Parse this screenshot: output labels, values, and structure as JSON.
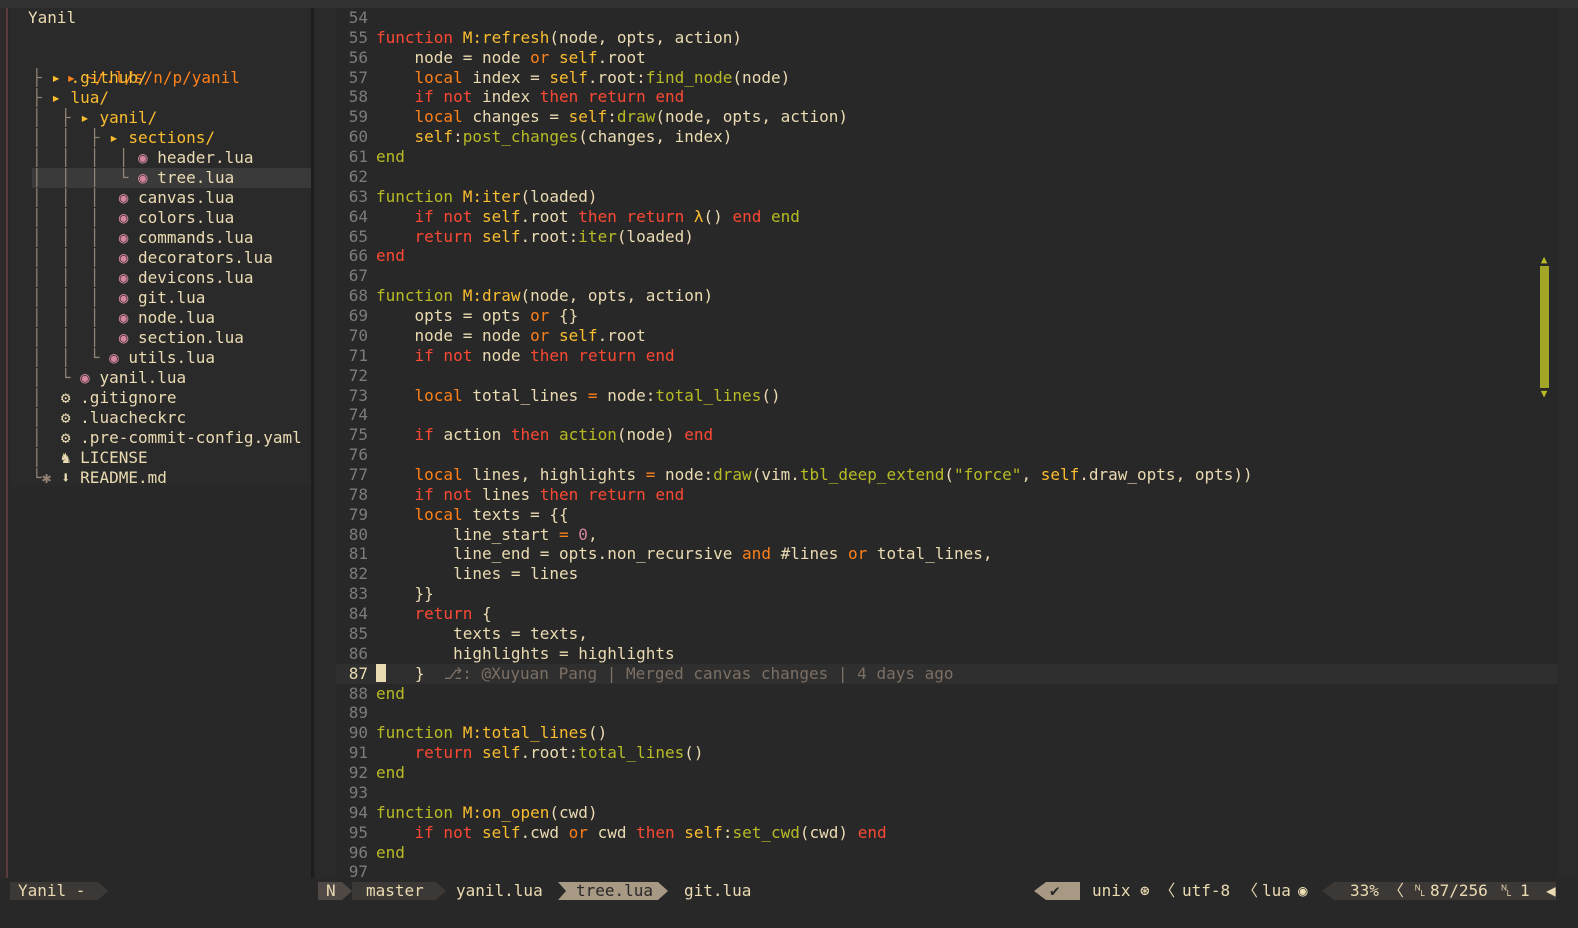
{
  "sidebar": {
    "title": "Yanil",
    "root": "~/.l/s/n/p/yanil",
    "items": [
      {
        "prefix": "├ ",
        "icon": "▸ ",
        "label": ".github/",
        "kind": "dir"
      },
      {
        "prefix": "├ ",
        "icon": "▸ ",
        "label": "lua/",
        "kind": "dir"
      },
      {
        "prefix": "│  ├ ",
        "icon": "▸ ",
        "label": "yanil/",
        "kind": "dir"
      },
      {
        "prefix": "│  │  ├ ",
        "icon": "▸ ",
        "label": "sections/",
        "kind": "dir"
      },
      {
        "prefix": "│  │  │  │ ",
        "icon": "◉ ",
        "label": "header.lua",
        "kind": "lua"
      },
      {
        "prefix": "│  │  │  └ ",
        "icon": "◉ ",
        "label": "tree.lua",
        "kind": "lua"
      },
      {
        "prefix": "│  │  │  ",
        "icon": "◉ ",
        "label": "canvas.lua",
        "kind": "lua"
      },
      {
        "prefix": "│  │  │  ",
        "icon": "◉ ",
        "label": "colors.lua",
        "kind": "lua"
      },
      {
        "prefix": "│  │  │  ",
        "icon": "◉ ",
        "label": "commands.lua",
        "kind": "lua"
      },
      {
        "prefix": "│  │  │  ",
        "icon": "◉ ",
        "label": "decorators.lua",
        "kind": "lua"
      },
      {
        "prefix": "│  │  │  ",
        "icon": "◉ ",
        "label": "devicons.lua",
        "kind": "lua"
      },
      {
        "prefix": "│  │  │  ",
        "icon": "◉ ",
        "label": "git.lua",
        "kind": "lua"
      },
      {
        "prefix": "│  │  │  ",
        "icon": "◉ ",
        "label": "node.lua",
        "kind": "lua"
      },
      {
        "prefix": "│  │  │  ",
        "icon": "◉ ",
        "label": "section.lua",
        "kind": "lua"
      },
      {
        "prefix": "│  │  └ ",
        "icon": "◉ ",
        "label": "utils.lua",
        "kind": "lua"
      },
      {
        "prefix": "│  └ ",
        "icon": "◉ ",
        "label": "yanil.lua",
        "kind": "lua"
      },
      {
        "prefix": "│  ",
        "icon": "⚙ ",
        "label": ".gitignore",
        "kind": "gear"
      },
      {
        "prefix": "│  ",
        "icon": "⚙ ",
        "label": ".luacheckrc",
        "kind": "gear"
      },
      {
        "prefix": "│  ",
        "icon": "⚙ ",
        "label": ".pre-commit-config.yaml",
        "kind": "gear"
      },
      {
        "prefix": "│  ",
        "icon": "♞ ",
        "label": "LICENSE",
        "kind": "gear"
      },
      {
        "prefix": "└✱ ",
        "icon": "⬇ ",
        "label": "README.md",
        "kind": "gear"
      }
    ],
    "selected_index": 5
  },
  "code": {
    "lines": [
      {
        "n": "54",
        "t": []
      },
      {
        "n": "55",
        "t": [
          [
            "k",
            "function "
          ],
          [
            "y",
            "M:refresh"
          ],
          [
            "w",
            "(node, opts, action)"
          ]
        ]
      },
      {
        "n": "56",
        "t": [
          [
            "w",
            "    node = node "
          ],
          [
            "o",
            "or "
          ],
          [
            "y",
            "self"
          ],
          [
            "w",
            ".root"
          ]
        ]
      },
      {
        "n": "57",
        "t": [
          [
            "o",
            "    local "
          ],
          [
            "w",
            "index = "
          ],
          [
            "y",
            "self"
          ],
          [
            "w",
            ".root:"
          ],
          [
            "f",
            "find_node"
          ],
          [
            "w",
            "(node)"
          ]
        ]
      },
      {
        "n": "58",
        "t": [
          [
            "k",
            "    if not "
          ],
          [
            "w",
            "index "
          ],
          [
            "k",
            "then return end"
          ]
        ]
      },
      {
        "n": "59",
        "t": [
          [
            "o",
            "    local "
          ],
          [
            "w",
            "changes = "
          ],
          [
            "y",
            "self"
          ],
          [
            "w",
            ":"
          ],
          [
            "f",
            "draw"
          ],
          [
            "w",
            "(node, opts, action)"
          ]
        ]
      },
      {
        "n": "60",
        "t": [
          [
            "y",
            "    self"
          ],
          [
            "w",
            ":"
          ],
          [
            "f",
            "post_changes"
          ],
          [
            "w",
            "(changes, index)"
          ]
        ]
      },
      {
        "n": "61",
        "t": [
          [
            "g",
            "end"
          ]
        ]
      },
      {
        "n": "62",
        "t": []
      },
      {
        "n": "63",
        "t": [
          [
            "g",
            "function "
          ],
          [
            "y",
            "M:iter"
          ],
          [
            "w",
            "(loaded)"
          ]
        ]
      },
      {
        "n": "64",
        "t": [
          [
            "k",
            "    if not "
          ],
          [
            "y",
            "self"
          ],
          [
            "w",
            ".root "
          ],
          [
            "k",
            "then return "
          ],
          [
            "y",
            "λ"
          ],
          [
            "w",
            "() "
          ],
          [
            "k",
            "end "
          ],
          [
            "g",
            "end"
          ]
        ]
      },
      {
        "n": "65",
        "t": [
          [
            "k",
            "    return "
          ],
          [
            "y",
            "self"
          ],
          [
            "w",
            ".root:"
          ],
          [
            "f",
            "iter"
          ],
          [
            "w",
            "(loaded)"
          ]
        ]
      },
      {
        "n": "66",
        "t": [
          [
            "k",
            "end"
          ]
        ]
      },
      {
        "n": "67",
        "t": []
      },
      {
        "n": "68",
        "t": [
          [
            "g",
            "function "
          ],
          [
            "y",
            "M:draw"
          ],
          [
            "w",
            "(node, opts, action)"
          ]
        ]
      },
      {
        "n": "69",
        "t": [
          [
            "w",
            "    opts = opts "
          ],
          [
            "o",
            "or "
          ],
          [
            "w",
            "{}"
          ]
        ]
      },
      {
        "n": "70",
        "t": [
          [
            "w",
            "    node = node "
          ],
          [
            "o",
            "or "
          ],
          [
            "y",
            "self"
          ],
          [
            "w",
            ".root"
          ]
        ]
      },
      {
        "n": "71",
        "t": [
          [
            "k",
            "    if not "
          ],
          [
            "w",
            "node "
          ],
          [
            "k",
            "then return end"
          ]
        ]
      },
      {
        "n": "72",
        "t": []
      },
      {
        "n": "73",
        "t": [
          [
            "o",
            "    local "
          ],
          [
            "w",
            "total_lines "
          ],
          [
            "o",
            "= "
          ],
          [
            "w",
            "node:"
          ],
          [
            "f",
            "total_lines"
          ],
          [
            "w",
            "()"
          ]
        ]
      },
      {
        "n": "74",
        "t": []
      },
      {
        "n": "75",
        "t": [
          [
            "k",
            "    if "
          ],
          [
            "w",
            "action "
          ],
          [
            "k",
            "then "
          ],
          [
            "f",
            "action"
          ],
          [
            "w",
            "(node) "
          ],
          [
            "k",
            "end"
          ]
        ]
      },
      {
        "n": "76",
        "t": []
      },
      {
        "n": "77",
        "t": [
          [
            "o",
            "    local "
          ],
          [
            "w",
            "lines, highlights "
          ],
          [
            "o",
            "= "
          ],
          [
            "w",
            "node:"
          ],
          [
            "f",
            "draw"
          ],
          [
            "w",
            "(vim."
          ],
          [
            "f",
            "tbl_deep_extend"
          ],
          [
            "w",
            "("
          ],
          [
            "str",
            "\"force\""
          ],
          [
            "w",
            ", "
          ],
          [
            "y",
            "self"
          ],
          [
            "w",
            ".draw_opts, opts))"
          ]
        ]
      },
      {
        "n": "78",
        "t": [
          [
            "k",
            "    if not "
          ],
          [
            "w",
            "lines "
          ],
          [
            "k",
            "then return end"
          ]
        ]
      },
      {
        "n": "79",
        "t": [
          [
            "o",
            "    local "
          ],
          [
            "w",
            "texts = {{"
          ]
        ]
      },
      {
        "n": "80",
        "t": [
          [
            "w",
            "        line_start "
          ],
          [
            "o",
            "= "
          ],
          [
            "n",
            "0"
          ],
          [
            "w",
            ","
          ]
        ]
      },
      {
        "n": "81",
        "t": [
          [
            "w",
            "        line_end = opts.non_recursive "
          ],
          [
            "o",
            "and "
          ],
          [
            "w",
            "#lines "
          ],
          [
            "o",
            "or "
          ],
          [
            "w",
            "total_lines,"
          ]
        ]
      },
      {
        "n": "82",
        "t": [
          [
            "w",
            "        lines = lines"
          ]
        ]
      },
      {
        "n": "83",
        "t": [
          [
            "w",
            "    }}"
          ]
        ]
      },
      {
        "n": "84",
        "t": [
          [
            "k",
            "    return "
          ],
          [
            "w",
            "{"
          ]
        ]
      },
      {
        "n": "85",
        "t": [
          [
            "w",
            "        texts = texts,"
          ]
        ]
      },
      {
        "n": "86",
        "t": [
          [
            "w",
            "        highlights = highlights"
          ]
        ]
      },
      {
        "n": "87",
        "t": [
          [
            "w",
            "   }  "
          ],
          [
            "cm",
            "⎇: @Xuyuan Pang | Merged canvas changes | 4 days ago"
          ]
        ],
        "current": true
      },
      {
        "n": "88",
        "t": [
          [
            "g",
            "end"
          ]
        ]
      },
      {
        "n": "89",
        "t": []
      },
      {
        "n": "90",
        "t": [
          [
            "g",
            "function "
          ],
          [
            "y",
            "M:total_lines"
          ],
          [
            "w",
            "()"
          ]
        ]
      },
      {
        "n": "91",
        "t": [
          [
            "k",
            "    return "
          ],
          [
            "y",
            "self"
          ],
          [
            "w",
            ".root:"
          ],
          [
            "f",
            "total_lines"
          ],
          [
            "w",
            "()"
          ]
        ]
      },
      {
        "n": "92",
        "t": [
          [
            "g",
            "end"
          ]
        ]
      },
      {
        "n": "93",
        "t": []
      },
      {
        "n": "94",
        "t": [
          [
            "g",
            "function "
          ],
          [
            "y",
            "M:on_open"
          ],
          [
            "w",
            "(cwd)"
          ]
        ]
      },
      {
        "n": "95",
        "t": [
          [
            "k",
            "    if not "
          ],
          [
            "y",
            "self"
          ],
          [
            "w",
            ".cwd "
          ],
          [
            "o",
            "or "
          ],
          [
            "w",
            "cwd "
          ],
          [
            "k",
            "then "
          ],
          [
            "y",
            "self"
          ],
          [
            "w",
            ":"
          ],
          [
            "f",
            "set_cwd"
          ],
          [
            "w",
            "(cwd) "
          ],
          [
            "k",
            "end"
          ]
        ]
      },
      {
        "n": "96",
        "t": [
          [
            "g",
            "end"
          ]
        ]
      },
      {
        "n": "97",
        "t": []
      }
    ]
  },
  "status": {
    "left_title": "Yanil -",
    "mode": "N",
    "branch": "master",
    "buffers": [
      "yanil.lua",
      "tree.lua",
      "git.lua"
    ],
    "active_buffer": "tree.lua",
    "check": "✔",
    "format": "unix",
    "encoding": "utf-8",
    "filetype": "lua",
    "percent": "33%",
    "position": "87/256",
    "column": "1"
  }
}
